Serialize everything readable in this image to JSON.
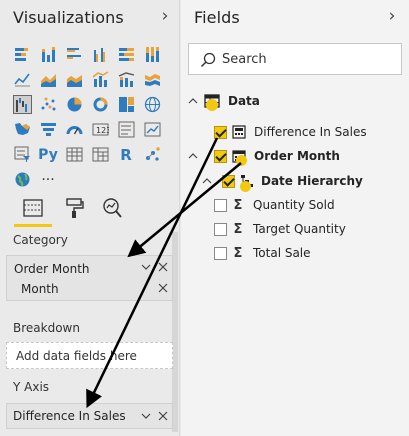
{
  "visualizations": {
    "title": "Visualizations",
    "icons": [
      [
        "stacked-bar-chart",
        "stacked-column-chart",
        "clustered-bar-chart",
        "clustered-column-chart",
        "100-percent-bar-chart",
        "100-percent-column-chart"
      ],
      [
        "line-chart",
        "area-chart",
        "stacked-area-chart",
        "line-and-column-chart",
        "line-and-stacked-column-chart",
        "ribbon-chart"
      ],
      [
        "waterfall-chart",
        "scatter-chart",
        "pie-chart",
        "donut-chart",
        "treemap",
        "map"
      ],
      [
        "filled-map",
        "funnel",
        "gauge",
        "card",
        "multi-row-card",
        "kpi"
      ],
      [
        "slicer",
        "python-visual",
        "table",
        "matrix",
        "r-visual",
        "key-influencers"
      ],
      [
        "globe-visual",
        "more-visuals"
      ]
    ],
    "python_label": "Py",
    "r_label": "R",
    "more_label": "···",
    "tabs": [
      "fields-tab",
      "format-tab",
      "analytics-tab"
    ],
    "category_label": "Category",
    "category_fields": [
      "Order Month",
      "Month"
    ],
    "breakdown_label": "Breakdown",
    "breakdown_placeholder": "Add data fields here",
    "yaxis_label": "Y Axis",
    "yaxis_fields": [
      "Difference In Sales"
    ]
  },
  "fields": {
    "title": "Fields",
    "search_placeholder": "Search",
    "table_name": "Data",
    "items": [
      {
        "label": "Difference In Sales",
        "checked": true,
        "type": "measure"
      },
      {
        "label": "Order Month",
        "checked": true,
        "type": "date"
      },
      {
        "label": "Date Hierarchy",
        "checked": true,
        "type": "hierarchy"
      },
      {
        "label": "Quantity Sold",
        "checked": false,
        "type": "sigma"
      },
      {
        "label": "Target Quantity",
        "checked": false,
        "type": "sigma"
      },
      {
        "label": "Total Sale",
        "checked": false,
        "type": "sigma"
      }
    ]
  },
  "colors": {
    "accent": "#f2c811",
    "arrow": "#000000"
  }
}
